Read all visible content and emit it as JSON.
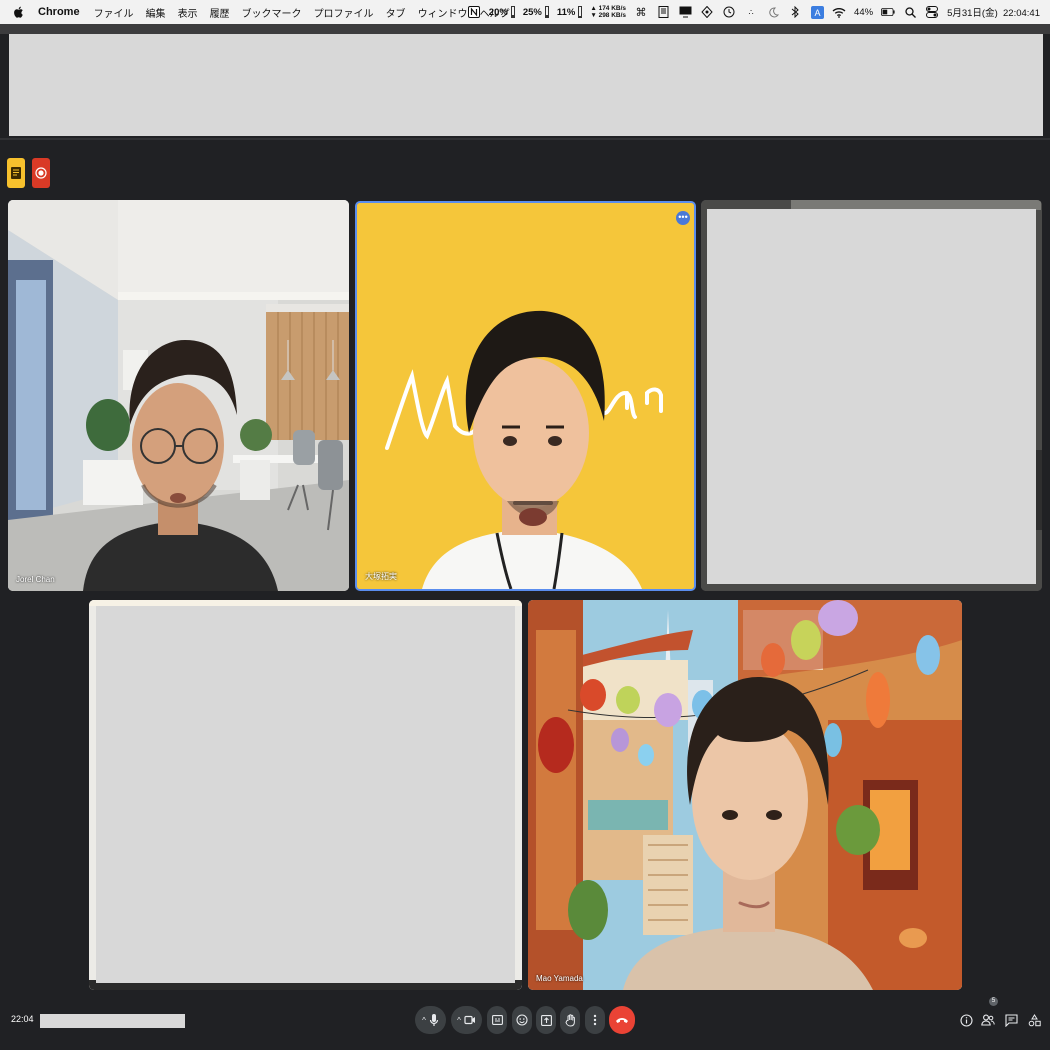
{
  "menubar": {
    "app_name": "Chrome",
    "menus": [
      "ファイル",
      "編集",
      "表示",
      "履歴",
      "ブックマーク",
      "プロファイル",
      "タブ",
      "ウィンドウ",
      "ヘルプ"
    ],
    "cpu": "20%",
    "memory": "25%",
    "disk": "11%",
    "net_up": "174 KB/s",
    "net_down": "298 KB/s",
    "battery": "44%",
    "datetime": "5月31日(金)  22:04:41"
  },
  "meet": {
    "tiles": [
      {
        "name": "Jorel Chan"
      },
      {
        "name": "大塚拓実",
        "board_text": "Mo        n"
      },
      {
        "name": ""
      },
      {
        "name": ""
      },
      {
        "name": "Mao Yamada"
      }
    ],
    "meeting_time": "22:04",
    "participant_count": "5",
    "more_options_glyph": "•••"
  },
  "colors": {
    "meet_background": "#202124",
    "active_speaker_border": "#5a8dee",
    "hangup": "#ea4335",
    "notes_button": "#f7c12d",
    "record_button": "#d93a26"
  },
  "icons": {
    "bottom_controls": [
      "mic-icon",
      "camera-icon",
      "captions-icon",
      "emoji-icon",
      "present-icon",
      "raise-hand-icon",
      "more-icon",
      "hangup-icon"
    ],
    "right_panel": [
      "info-icon",
      "people-icon",
      "chat-icon",
      "activities-icon"
    ]
  }
}
